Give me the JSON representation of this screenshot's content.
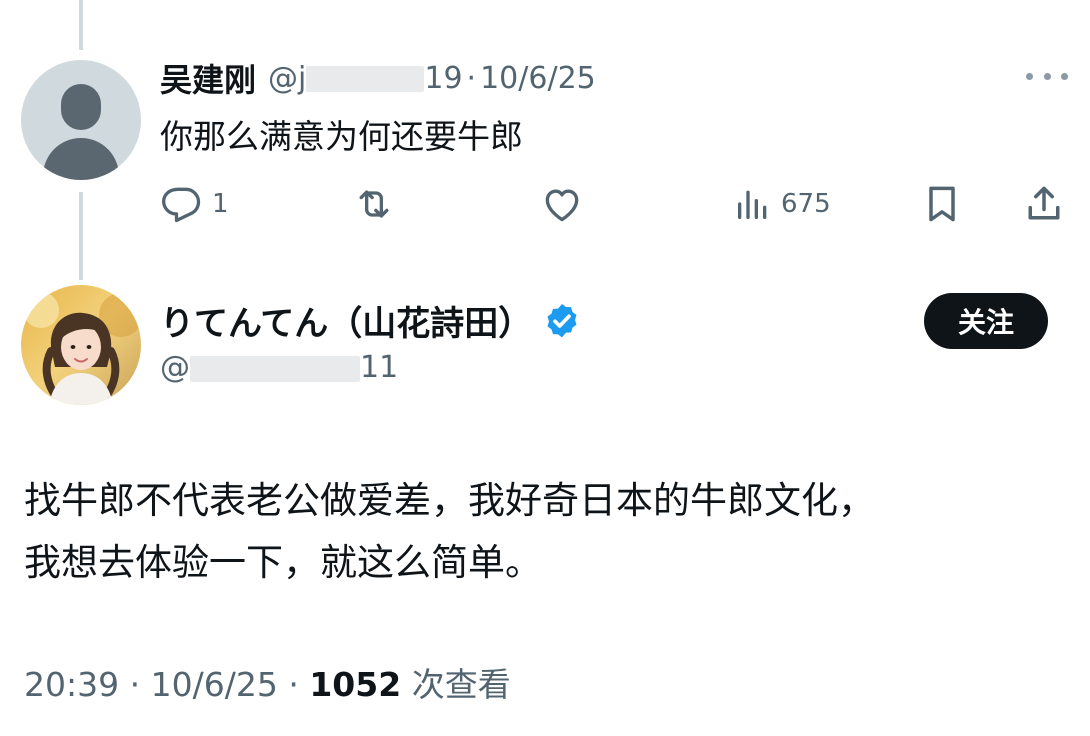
{
  "reply": {
    "name": "吴建刚",
    "handle_prefix": "@j",
    "handle_tail": "19",
    "separator": "·",
    "date": "10/6/25",
    "text": "你那么满意为何还要牛郎",
    "actions": {
      "reply_count": "1",
      "views_count": "675"
    }
  },
  "tweet": {
    "author_name": "りてんてん（山花詩田）",
    "handle_prefix": "@",
    "handle_tail": "11",
    "follow_label": "关注",
    "text_lines": [
      "找牛郎不代表老公做爱差，我好奇日本的牛郎文化，",
      "我想去体验一下，就这么简单。"
    ],
    "time": "20:39",
    "separator": "·",
    "date": "10/6/25",
    "views_count": "1052",
    "views_label": "次查看"
  },
  "colors": {
    "text_primary": "#0f1419",
    "text_secondary": "#536471",
    "verified_blue": "#1d9bf0",
    "thread_line": "#cfd9de",
    "follow_bg": "#0f1419"
  },
  "icons": {
    "reply": "comment-icon",
    "retweet": "retweet-icon",
    "like": "heart-icon",
    "views": "analytics-icon",
    "bookmark": "bookmark-icon",
    "share": "share-icon",
    "more": "more-icon",
    "verified": "verified-badge-icon"
  }
}
